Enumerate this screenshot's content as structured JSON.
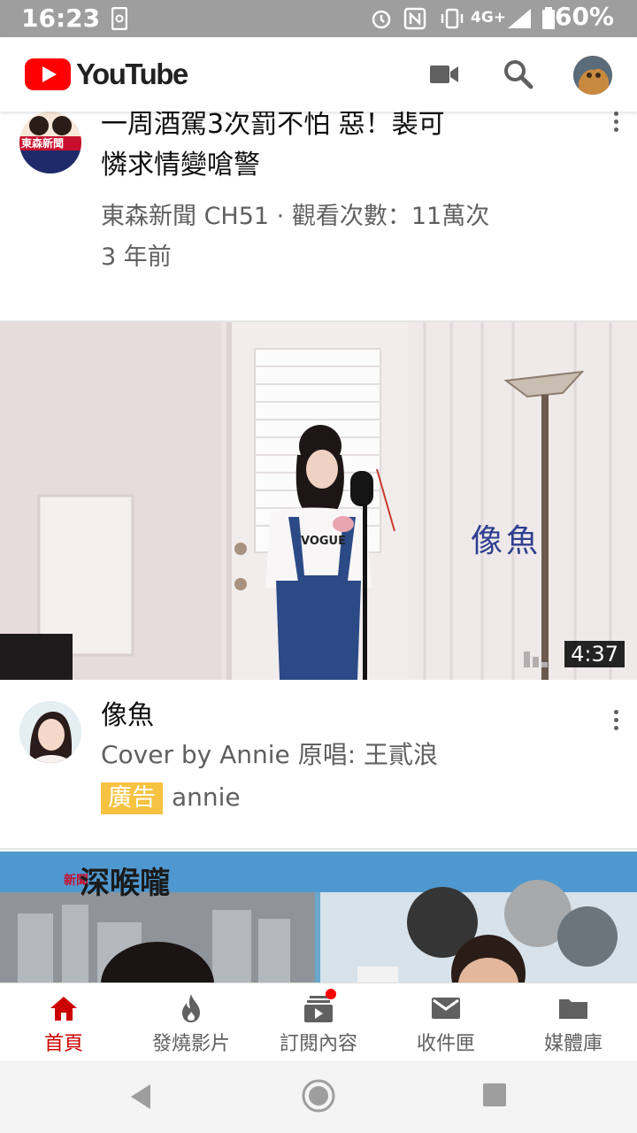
{
  "status_bar": {
    "time": "16:23",
    "battery": "60%",
    "network": "4G+"
  },
  "app": {
    "name": "YouTube",
    "brand_color": "#ff0000"
  },
  "header": {
    "icons": [
      "camera-icon",
      "search-icon",
      "account-avatar"
    ]
  },
  "feed": {
    "item1": {
      "title_line1": "一周酒駕3次罰不怕 惡！裴可",
      "title_line2": "憐求情變嗆警",
      "meta_line1": "東森新聞 CH51 · 觀看次數：11萬次",
      "meta_line2": "3 年前",
      "avatar_text": "東森新聞"
    },
    "item2": {
      "duration": "4:37",
      "overlay_text": "像魚",
      "title": "像魚",
      "subtitle": "Cover by Annie 原唱: 王貳浪",
      "ad_badge": "廣告",
      "channel": "annie",
      "shirt_text": "VOGUE"
    },
    "item3": {
      "banner_text": "深喉嚨",
      "banner_small": "新聞"
    }
  },
  "bottom_nav": [
    {
      "label": "首頁",
      "icon": "home-icon",
      "active": true
    },
    {
      "label": "發燒影片",
      "icon": "flame-icon",
      "active": false
    },
    {
      "label": "訂閱內容",
      "icon": "subscriptions-icon",
      "active": false,
      "badge": true
    },
    {
      "label": "收件匣",
      "icon": "mail-icon",
      "active": false
    },
    {
      "label": "媒體庫",
      "icon": "folder-icon",
      "active": false
    }
  ],
  "colors": {
    "accent_red": "#cc0000",
    "ad_yellow": "#f5c242",
    "text_secondary": "#606060"
  }
}
